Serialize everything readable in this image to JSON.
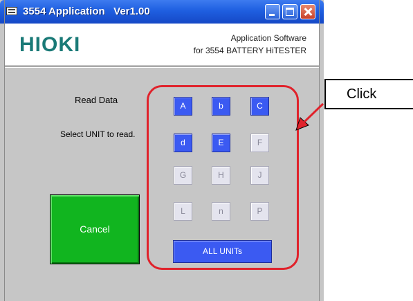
{
  "window": {
    "title": "3554 Application   Ver1.00"
  },
  "header": {
    "logo": "HIOKI",
    "subtitle_line1": "Application Software",
    "subtitle_line2": "for 3554 BATTERY HiTESTER"
  },
  "labels": {
    "read_data": "Read Data",
    "select_unit": "Select UNIT to read."
  },
  "buttons": {
    "cancel": "Cancel",
    "all_units": "ALL UNITs"
  },
  "units": [
    {
      "label": "A",
      "enabled": true
    },
    {
      "label": "b",
      "enabled": true
    },
    {
      "label": "C",
      "enabled": true
    },
    {
      "label": "d",
      "enabled": true
    },
    {
      "label": "E",
      "enabled": true
    },
    {
      "label": "F",
      "enabled": false
    },
    {
      "label": "G",
      "enabled": false
    },
    {
      "label": "H",
      "enabled": false
    },
    {
      "label": "J",
      "enabled": false
    },
    {
      "label": "L",
      "enabled": false
    },
    {
      "label": "n",
      "enabled": false
    },
    {
      "label": "P",
      "enabled": false
    }
  ],
  "callout": {
    "text": "Click"
  },
  "colors": {
    "titlebar": "#1f5fe0",
    "unit_enabled": "#3b5af2",
    "unit_disabled": "#e4e4ee",
    "cancel": "#11b51f",
    "highlight": "#e0222b",
    "logo": "#1a7a77"
  },
  "icons": [
    "app-icon",
    "minimize-icon",
    "maximize-icon",
    "close-icon",
    "arrow-icon"
  ]
}
